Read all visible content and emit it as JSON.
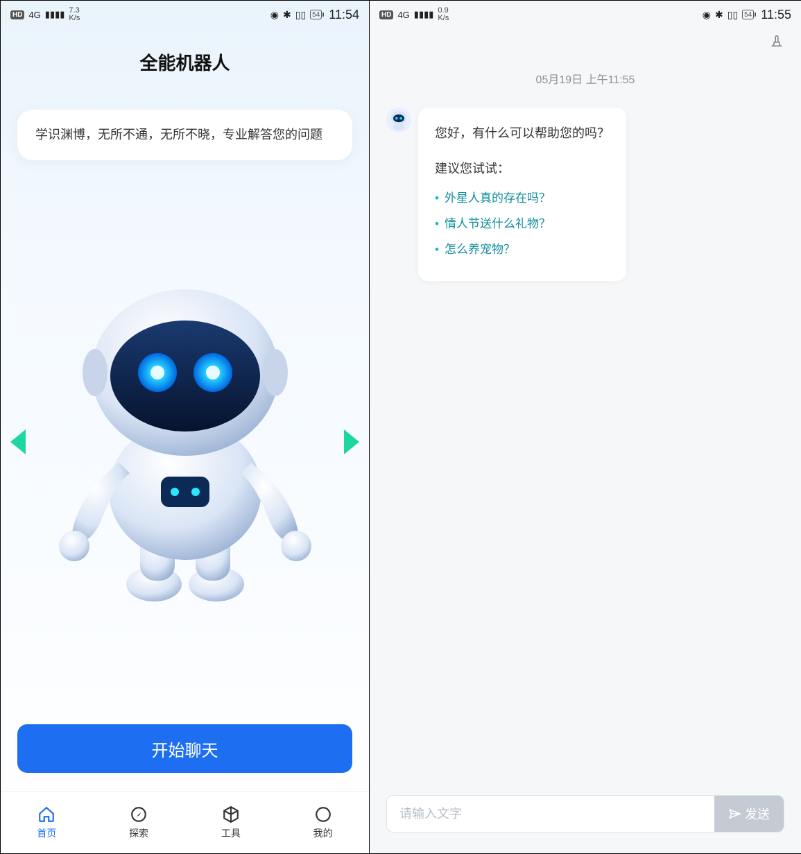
{
  "left": {
    "status": {
      "hd": "HD",
      "network_label": "4G",
      "speed": "7.3\nK/s",
      "battery": "54",
      "clock": "11:54"
    },
    "title": "全能机器人",
    "description": "学识渊博，无所不通，无所不晓，专业解答您的问题",
    "start_button": "开始聊天",
    "nav": [
      {
        "key": "home",
        "label": "首页",
        "active": true
      },
      {
        "key": "explore",
        "label": "探索",
        "active": false
      },
      {
        "key": "tools",
        "label": "工具",
        "active": false
      },
      {
        "key": "mine",
        "label": "我的",
        "active": false
      }
    ]
  },
  "right": {
    "status": {
      "hd": "HD",
      "network_label": "4G",
      "speed": "0.9\nK/s",
      "battery": "54",
      "clock": "11:55"
    },
    "timestamp": "05月19日 上午11:55",
    "greeting": "您好，有什么可以帮助您的吗？",
    "try_label": "建议您试试：",
    "suggestions": [
      "外星人真的存在吗？",
      "情人节送什么礼物？",
      "怎么养宠物？"
    ],
    "input_placeholder": "请输入文字",
    "send_label": "发送"
  }
}
